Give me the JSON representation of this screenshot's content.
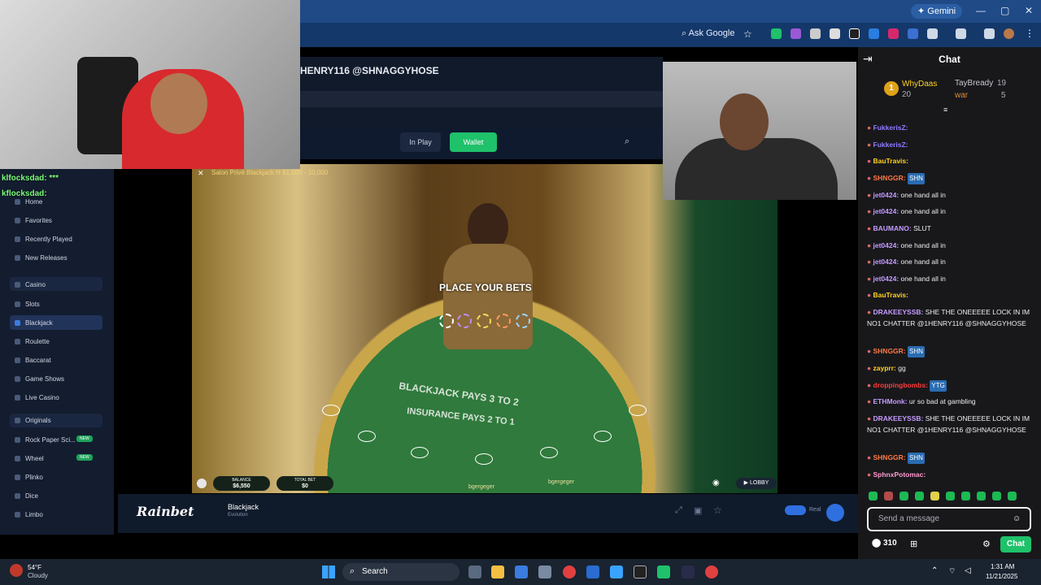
{
  "browser": {
    "gemini_label": "Gemini",
    "ask_google": "Ask Google",
    "window_controls": [
      "—",
      "▢",
      "✕"
    ]
  },
  "stream_overlay": {
    "top_user_text": "HENRY116 @SHNAGGYHOSE",
    "overlay_chat": [
      "klfocksdad: ***",
      "kflocksdad:"
    ]
  },
  "rainbet": {
    "nav_inplay": "In Play",
    "nav_wallet": "Wallet",
    "sidebar": [
      {
        "label": "Home"
      },
      {
        "label": "Favorites"
      },
      {
        "label": "Recently Played"
      },
      {
        "label": "New Releases"
      },
      {
        "label": "Casino"
      },
      {
        "label": "Slots"
      },
      {
        "label": "Blackjack"
      },
      {
        "label": "Roulette"
      },
      {
        "label": "Baccarat"
      },
      {
        "label": "Game Shows"
      },
      {
        "label": "Live Casino"
      },
      {
        "label": "Originals"
      },
      {
        "label": "Rock Paper Sci...",
        "badge": "NEW"
      },
      {
        "label": "Wheel",
        "badge": "NEW"
      },
      {
        "label": "Plinko"
      },
      {
        "label": "Dice"
      },
      {
        "label": "Limbo"
      }
    ],
    "game_title": "Salon Privé Blackjack H  $1,000 - 10,000",
    "place_bets": "PLACE YOUR BETS",
    "felt_line1": "BLACKJACK PAYS 3 TO 2",
    "felt_line2": "INSURANCE PAYS 2 TO 1",
    "balance_label": "BALANCE",
    "balance_value": "$6,550",
    "totalbet_label": "TOTAL BET",
    "totalbet_value": "$0",
    "lobby": "LOBBY",
    "seat_names": [
      "bgergeger",
      "bgergeger"
    ],
    "logo": "Rainbet",
    "footer_game": "Blackjack",
    "footer_provider": "Evolution",
    "footer_mode": "Real"
  },
  "chat": {
    "title": "Chat",
    "leaderboard": [
      {
        "name": "WhyDaas",
        "value": "20",
        "rank": "1"
      },
      {
        "name": "TayBready",
        "value": "19"
      },
      {
        "name": "war",
        "value": "5"
      }
    ],
    "messages": [
      {
        "user": "FukkerisZ:",
        "text": "",
        "color": "#8d7bff"
      },
      {
        "user": "FukkerisZ:",
        "text": "",
        "color": "#8d7bff"
      },
      {
        "user": "BauTravis:",
        "text": "",
        "color": "#ffd21f"
      },
      {
        "user": "SHNGGR:",
        "text": "SHN",
        "color": "#ff7a45"
      },
      {
        "user": "jet0424:",
        "text": "one hand all in",
        "color": "#c59cff"
      },
      {
        "user": "jet0424:",
        "text": "one hand all in",
        "color": "#c59cff"
      },
      {
        "user": "BAUMANO:",
        "text": "SLUT",
        "color": "#c59cff"
      },
      {
        "user": "jet0424:",
        "text": "one hand all in",
        "color": "#c59cff"
      },
      {
        "user": "jet0424:",
        "text": "one hand all in",
        "color": "#c59cff"
      },
      {
        "user": "jet0424:",
        "text": "one hand all in",
        "color": "#c59cff"
      },
      {
        "user": "BauTravis:",
        "text": "",
        "color": "#ffd21f"
      },
      {
        "user": "DRAKEEYSSB:",
        "text": "SHE THE ONEEEEE LOCK IN IM NO1 CHATTER @1HENRY116 @SHNAGGYHOSE",
        "color": "#c59cff"
      },
      {
        "user": "SHNGGR:",
        "text": "SHN",
        "color": "#ff7a45"
      },
      {
        "user": "zayprr:",
        "text": "gg",
        "color": "#ffd21f"
      },
      {
        "user": "droppingbombs:",
        "text": "YTG",
        "color": "#ff3b3b"
      },
      {
        "user": "ETHMonk:",
        "text": "ur so bad at gambling",
        "color": "#c59cff"
      },
      {
        "user": "DRAKEEYSSB:",
        "text": "SHE THE ONEEEEE LOCK IN IM NO1 CHATTER @1HENRY116 @SHNAGGYHOSE",
        "color": "#c59cff"
      },
      {
        "user": "SHNGGR:",
        "text": "SHN",
        "color": "#ff7a45"
      },
      {
        "user": "SphnxPotomac:",
        "text": "",
        "color": "#ff9ad1"
      }
    ],
    "input_placeholder": "Send a message",
    "points": "310",
    "send_label": "Chat"
  },
  "taskbar": {
    "temp": "54°F",
    "weather": "Cloudy",
    "search": "Search",
    "time": "1:31 AM",
    "date": "11/21/2025"
  },
  "colors": {
    "chat_bg": "#18181b",
    "accent_green": "#1fc16a",
    "browser_blue": "#1f4a86"
  }
}
